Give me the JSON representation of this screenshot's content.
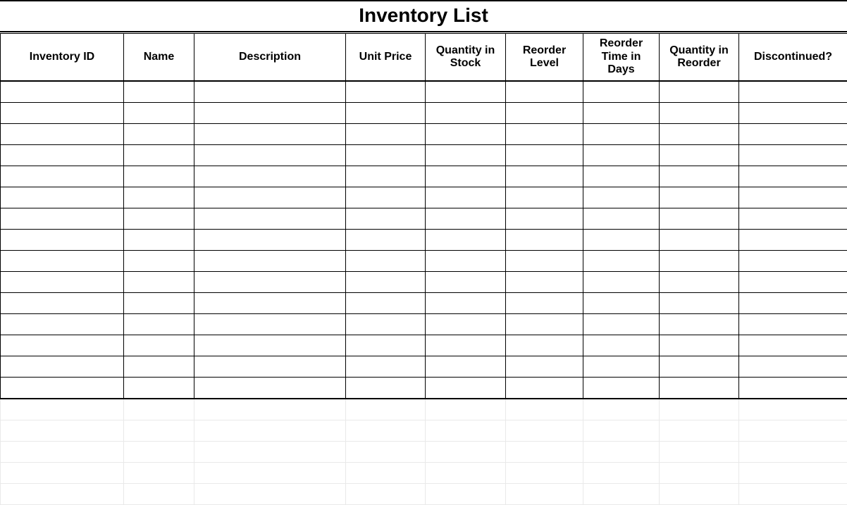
{
  "title": "Inventory List",
  "columns": [
    "Inventory ID",
    "Name",
    "Description",
    "Unit Price",
    "Quantity in Stock",
    "Reorder Level",
    "Reorder Time in Days",
    "Quantity in Reorder",
    "Discontinued?"
  ],
  "rows": [
    {
      "inventory_id": "",
      "name": "",
      "description": "",
      "unit_price": "",
      "quantity_in_stock": "",
      "reorder_level": "",
      "reorder_time_in_days": "",
      "quantity_in_reorder": "",
      "discontinued": ""
    },
    {
      "inventory_id": "",
      "name": "",
      "description": "",
      "unit_price": "",
      "quantity_in_stock": "",
      "reorder_level": "",
      "reorder_time_in_days": "",
      "quantity_in_reorder": "",
      "discontinued": ""
    },
    {
      "inventory_id": "",
      "name": "",
      "description": "",
      "unit_price": "",
      "quantity_in_stock": "",
      "reorder_level": "",
      "reorder_time_in_days": "",
      "quantity_in_reorder": "",
      "discontinued": ""
    },
    {
      "inventory_id": "",
      "name": "",
      "description": "",
      "unit_price": "",
      "quantity_in_stock": "",
      "reorder_level": "",
      "reorder_time_in_days": "",
      "quantity_in_reorder": "",
      "discontinued": ""
    },
    {
      "inventory_id": "",
      "name": "",
      "description": "",
      "unit_price": "",
      "quantity_in_stock": "",
      "reorder_level": "",
      "reorder_time_in_days": "",
      "quantity_in_reorder": "",
      "discontinued": ""
    },
    {
      "inventory_id": "",
      "name": "",
      "description": "",
      "unit_price": "",
      "quantity_in_stock": "",
      "reorder_level": "",
      "reorder_time_in_days": "",
      "quantity_in_reorder": "",
      "discontinued": ""
    },
    {
      "inventory_id": "",
      "name": "",
      "description": "",
      "unit_price": "",
      "quantity_in_stock": "",
      "reorder_level": "",
      "reorder_time_in_days": "",
      "quantity_in_reorder": "",
      "discontinued": ""
    },
    {
      "inventory_id": "",
      "name": "",
      "description": "",
      "unit_price": "",
      "quantity_in_stock": "",
      "reorder_level": "",
      "reorder_time_in_days": "",
      "quantity_in_reorder": "",
      "discontinued": ""
    },
    {
      "inventory_id": "",
      "name": "",
      "description": "",
      "unit_price": "",
      "quantity_in_stock": "",
      "reorder_level": "",
      "reorder_time_in_days": "",
      "quantity_in_reorder": "",
      "discontinued": ""
    },
    {
      "inventory_id": "",
      "name": "",
      "description": "",
      "unit_price": "",
      "quantity_in_stock": "",
      "reorder_level": "",
      "reorder_time_in_days": "",
      "quantity_in_reorder": "",
      "discontinued": ""
    },
    {
      "inventory_id": "",
      "name": "",
      "description": "",
      "unit_price": "",
      "quantity_in_stock": "",
      "reorder_level": "",
      "reorder_time_in_days": "",
      "quantity_in_reorder": "",
      "discontinued": ""
    },
    {
      "inventory_id": "",
      "name": "",
      "description": "",
      "unit_price": "",
      "quantity_in_stock": "",
      "reorder_level": "",
      "reorder_time_in_days": "",
      "quantity_in_reorder": "",
      "discontinued": ""
    },
    {
      "inventory_id": "",
      "name": "",
      "description": "",
      "unit_price": "",
      "quantity_in_stock": "",
      "reorder_level": "",
      "reorder_time_in_days": "",
      "quantity_in_reorder": "",
      "discontinued": ""
    },
    {
      "inventory_id": "",
      "name": "",
      "description": "",
      "unit_price": "",
      "quantity_in_stock": "",
      "reorder_level": "",
      "reorder_time_in_days": "",
      "quantity_in_reorder": "",
      "discontinued": ""
    },
    {
      "inventory_id": "",
      "name": "",
      "description": "",
      "unit_price": "",
      "quantity_in_stock": "",
      "reorder_level": "",
      "reorder_time_in_days": "",
      "quantity_in_reorder": "",
      "discontinued": ""
    }
  ],
  "column_keys": [
    "inventory_id",
    "name",
    "description",
    "unit_price",
    "quantity_in_stock",
    "reorder_level",
    "reorder_time_in_days",
    "quantity_in_reorder",
    "discontinued"
  ],
  "bordered_row_count": 15,
  "faint_row_count": 5
}
